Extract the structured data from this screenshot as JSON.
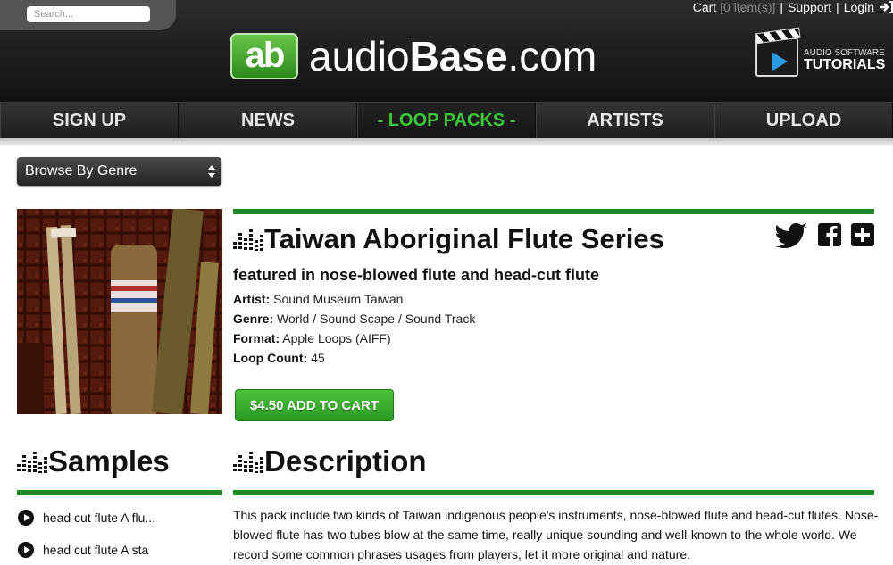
{
  "header": {
    "search": {
      "placeholder": "Search...",
      "value": ""
    },
    "top_links": {
      "cart": "Cart",
      "cart_count": "[0 item(s)]",
      "support": "Support",
      "login": "Login",
      "separator": "|"
    },
    "logo": {
      "badge": "ab",
      "text_light1": "audio",
      "text_bold": "Base",
      "text_light2": ".com"
    },
    "tutorials": {
      "line1": "AUDIO SOFTWARE",
      "line2": "TUTORIALS"
    }
  },
  "nav": {
    "items": [
      {
        "label": "SIGN UP"
      },
      {
        "label": "NEWS"
      },
      {
        "label": "- LOOP PACKS -"
      },
      {
        "label": "ARTISTS"
      },
      {
        "label": "UPLOAD"
      }
    ],
    "active_index": 2
  },
  "genre_select": {
    "value": "Browse By Genre"
  },
  "product": {
    "title": "Taiwan Aboriginal Flute Series",
    "subtitle": "featured in nose-blowed flute and head-cut flute",
    "artist_label": "Artist:",
    "artist": "Sound Museum Taiwan",
    "genre_label": "Genre:",
    "genre": "World / Sound Scape / Sound Track",
    "format_label": "Format:",
    "format": "Apple Loops (AIFF)",
    "loop_count_label": "Loop Count:",
    "loop_count": "45",
    "cart_button": "$4.50 ADD TO CART",
    "share_icons": [
      "twitter-icon",
      "facebook-icon",
      "plus-icon"
    ]
  },
  "samples": {
    "heading": "Samples",
    "items": [
      {
        "label": "head cut flute A flu..."
      },
      {
        "label": "head cut flute A sta"
      }
    ]
  },
  "description": {
    "heading": "Description",
    "text": "This pack include two kinds of Taiwan indigenous people's instruments, nose-blowed flute and head-cut flutes. Nose-blowed flute has two tubes blow at the same time, really unique sounding and well-known to the whole world. We record some common phrases usages from players, let it more original and nature."
  },
  "colors": {
    "accent_green": "#1c8a24",
    "nav_active": "#3cc63c",
    "header_bg": "#1a1a1a"
  }
}
